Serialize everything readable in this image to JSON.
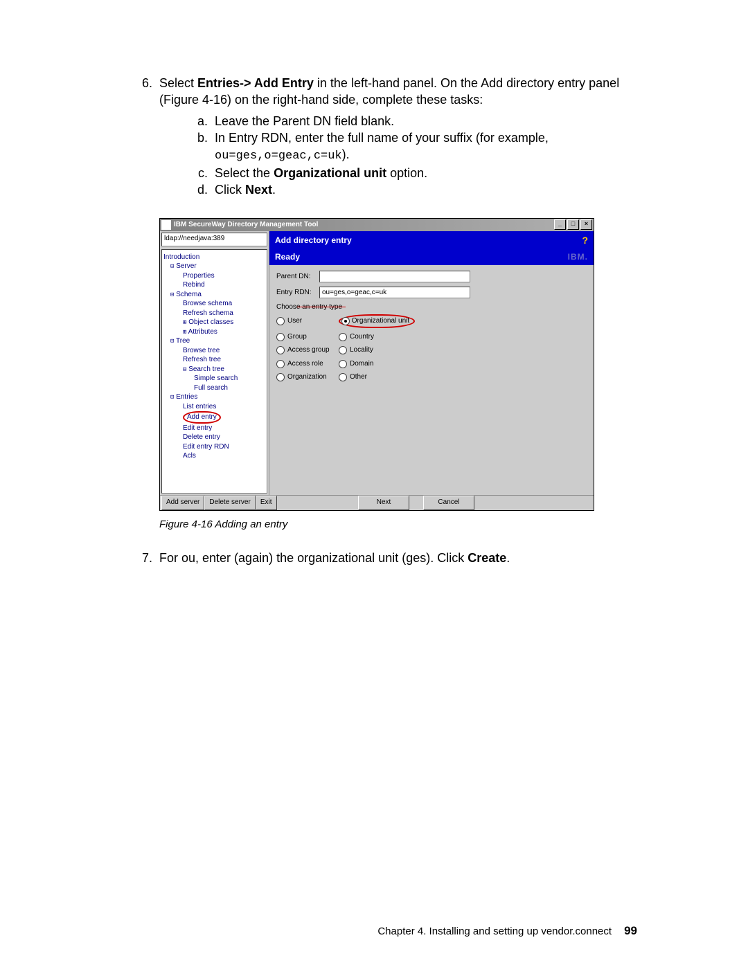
{
  "step6": {
    "number": "6.",
    "text_a": "Select ",
    "bold_a": "Entries-> Add Entry ",
    "text_b": "in the left-hand panel. On the Add directory entry panel ",
    "text_c": "(Figure 4-16) on the right-hand side, complete these tasks:",
    "a_letter": "a.",
    "a_text": "Leave the Parent DN field blank.",
    "b_letter": "b.",
    "b_text_a": "In Entry RDN, enter the full name of your suffix (for example, ",
    "b_code": "ou=ges,o=geac,c=uk",
    "b_text_b": ").",
    "c_letter": "c.",
    "c_text_a": "Select the ",
    "c_bold": "Organizational unit ",
    "c_text_b": "option.",
    "d_letter": "d.",
    "d_text_a": "Click ",
    "d_bold": "Next",
    "d_text_b": "."
  },
  "screenshot": {
    "title": "IBM SecureWay Directory Management Tool",
    "win_min": "_",
    "win_max": "□",
    "win_close": "×",
    "ldap_url": "ldap://needjava:389",
    "tree": {
      "intro": "Introduction",
      "server": "Server",
      "properties": "Properties",
      "rebind": "Rebind",
      "schema": "Schema",
      "browse_schema": "Browse schema",
      "refresh_schema": "Refresh schema",
      "object_classes": "Object classes",
      "attributes": "Attributes",
      "tree_node": "Tree",
      "browse_tree": "Browse tree",
      "refresh_tree": "Refresh tree",
      "search_tree": "Search tree",
      "simple_search": "Simple search",
      "full_search": "Full search",
      "entries": "Entries",
      "list_entries": "List entries",
      "add_entry": "Add entry",
      "edit_entry": "Edit entry",
      "delete_entry": "Delete entry",
      "edit_entry_rdn": "Edit entry RDN",
      "acls": "Acls"
    },
    "header": {
      "title": "Add directory entry",
      "help": "?",
      "status": "Ready",
      "ibm": "IBM."
    },
    "form": {
      "parent_dn_label": "Parent DN:",
      "parent_dn_value": "",
      "entry_rdn_label": "Entry RDN:",
      "entry_rdn_value": "ou=ges,o=geac,c=uk",
      "choose_type": "Choose an entry type",
      "radios": {
        "user": "User",
        "org_unit": "Organizational unit",
        "group": "Group",
        "country": "Country",
        "access_group": "Access group",
        "locality": "Locality",
        "access_role": "Access role",
        "domain": "Domain",
        "organization": "Organization",
        "other": "Other"
      }
    },
    "buttons": {
      "add_server": "Add server",
      "delete_server": "Delete server",
      "exit": "Exit",
      "next": "Next",
      "cancel": "Cancel"
    }
  },
  "caption": "Figure 4-16   Adding an entry",
  "step7": {
    "number": "7.",
    "text_a": "For ou, enter (again) the organizational unit (ges). Click ",
    "bold": "Create",
    "text_b": "."
  },
  "footer": {
    "chapter": "Chapter 4. Installing and setting up vendor.connect",
    "page": "99"
  },
  "glyphs": {
    "box_minus": "⊟",
    "box_plus": "⊞",
    "doc": "🗋"
  }
}
